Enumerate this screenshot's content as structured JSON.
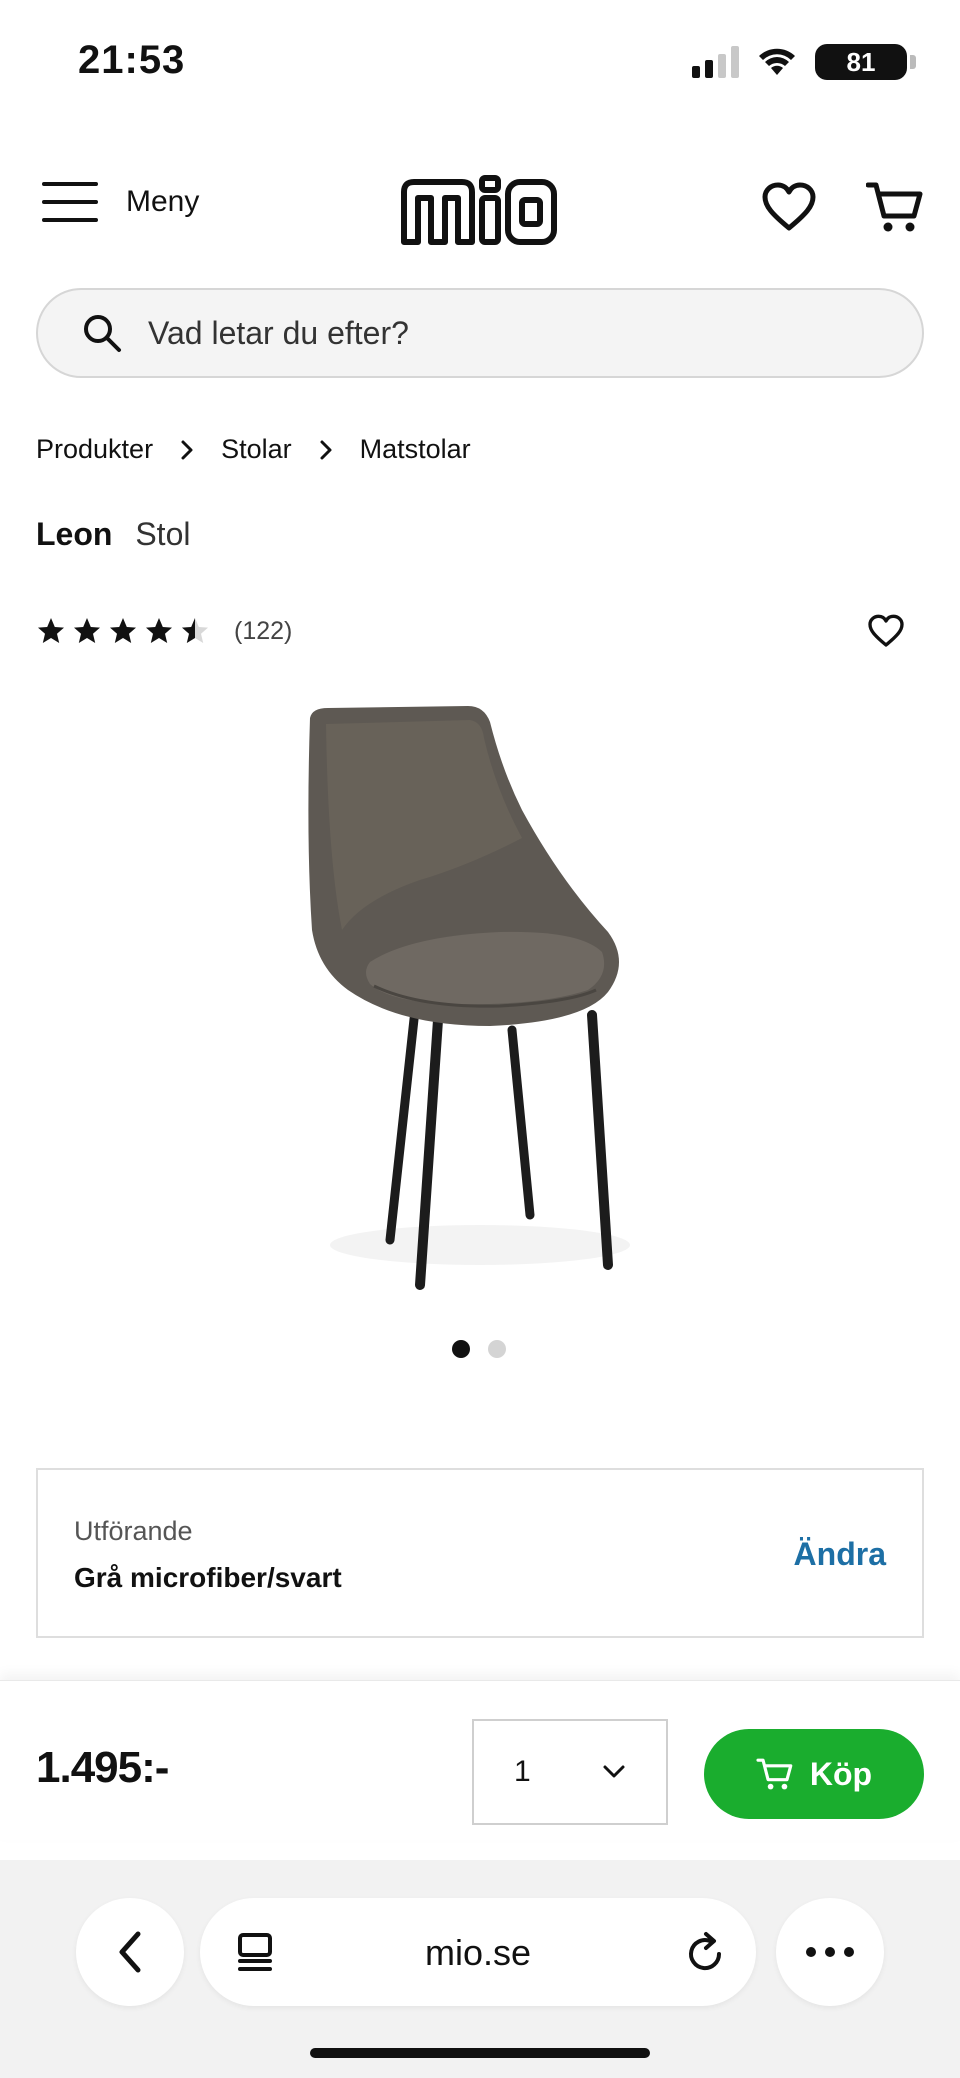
{
  "status_bar": {
    "time": "21:53",
    "battery": "81"
  },
  "header": {
    "menu_label": "Meny",
    "logo_text": "mio"
  },
  "search": {
    "placeholder": "Vad letar du efter?"
  },
  "breadcrumb": [
    "Produkter",
    "Stolar",
    "Matstolar"
  ],
  "product": {
    "brand": "Leon",
    "type": "Stol",
    "rating": 4.5,
    "rating_max": 5,
    "review_count": "(122)",
    "image_count": 2,
    "active_image": 1,
    "image_icon": "dining-chair-image"
  },
  "variant": {
    "label": "Utförande",
    "value": "Grå microfiber/svart",
    "change_label": "Ändra"
  },
  "purchase": {
    "price": "1.495:-",
    "quantity": "1",
    "buy_label": "Köp"
  },
  "browser": {
    "url": "mio.se"
  },
  "colors": {
    "buy_button": "#1aad2e",
    "link": "#1d6fa5",
    "text": "#111111"
  }
}
